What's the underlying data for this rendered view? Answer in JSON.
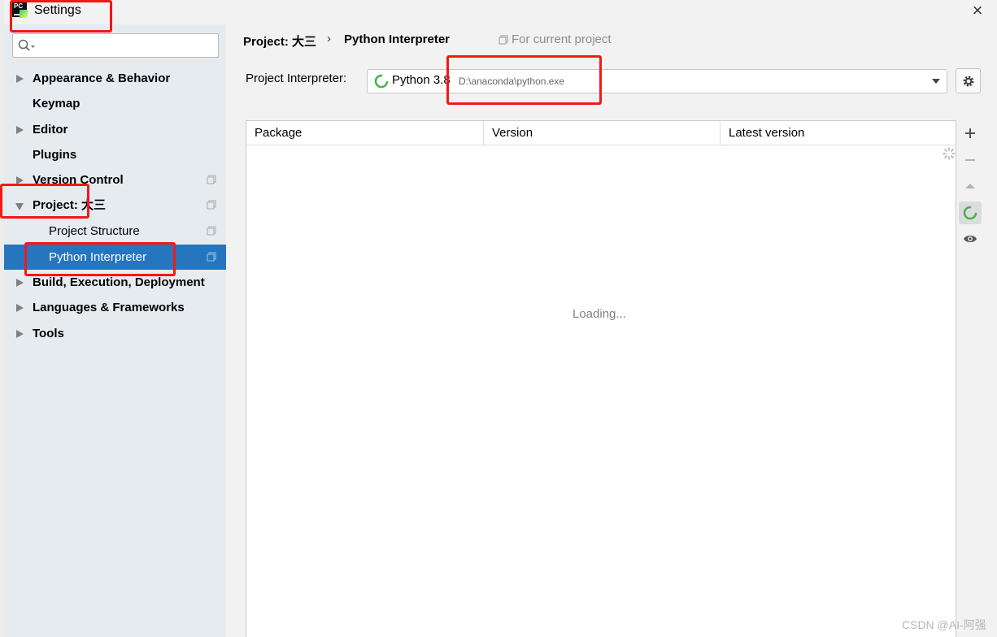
{
  "window": {
    "title": "Settings",
    "app_logo": "PC",
    "close_icon": "close-icon"
  },
  "search": {
    "icon": "search-icon",
    "placeholder": "",
    "value": ""
  },
  "tree": [
    {
      "label": "Appearance & Behavior",
      "bold": true,
      "expand": "collapsed"
    },
    {
      "label": "Keymap",
      "bold": true
    },
    {
      "label": "Editor",
      "bold": true,
      "expand": "collapsed"
    },
    {
      "label": "Plugins",
      "bold": true
    },
    {
      "label": "Version Control",
      "bold": true,
      "expand": "collapsed",
      "project_icon": true
    },
    {
      "label": "Project: 大三",
      "bold": true,
      "expand": "expanded",
      "project_icon": true
    },
    {
      "label": "Project Structure",
      "bold": false,
      "child": true,
      "project_icon": true
    },
    {
      "label": "Python Interpreter",
      "bold": false,
      "child": true,
      "selected": true,
      "project_icon": true
    },
    {
      "label": "Build, Execution, Deployment",
      "bold": true,
      "expand": "collapsed"
    },
    {
      "label": "Languages & Frameworks",
      "bold": true,
      "expand": "collapsed"
    },
    {
      "label": "Tools",
      "bold": true,
      "expand": "collapsed"
    }
  ],
  "breadcrumb": {
    "project": "Project: 大三",
    "separator": "›",
    "page": "Python Interpreter",
    "scope": "For current project"
  },
  "interpreter": {
    "label": "Project Interpreter:",
    "name": "Python 3.8",
    "path": "D:\\anaconda\\python.exe"
  },
  "packages": {
    "columns": [
      "Package",
      "Version",
      "Latest version"
    ],
    "rows": [],
    "status": "Loading..."
  },
  "tools": [
    "plus-icon",
    "minus-icon",
    "arrow-up-icon",
    "refresh-icon",
    "eye-icon"
  ],
  "watermark": "CSDN @AI-阿强",
  "colors": {
    "selection": "#2675bf",
    "annotation": "#f21818"
  }
}
